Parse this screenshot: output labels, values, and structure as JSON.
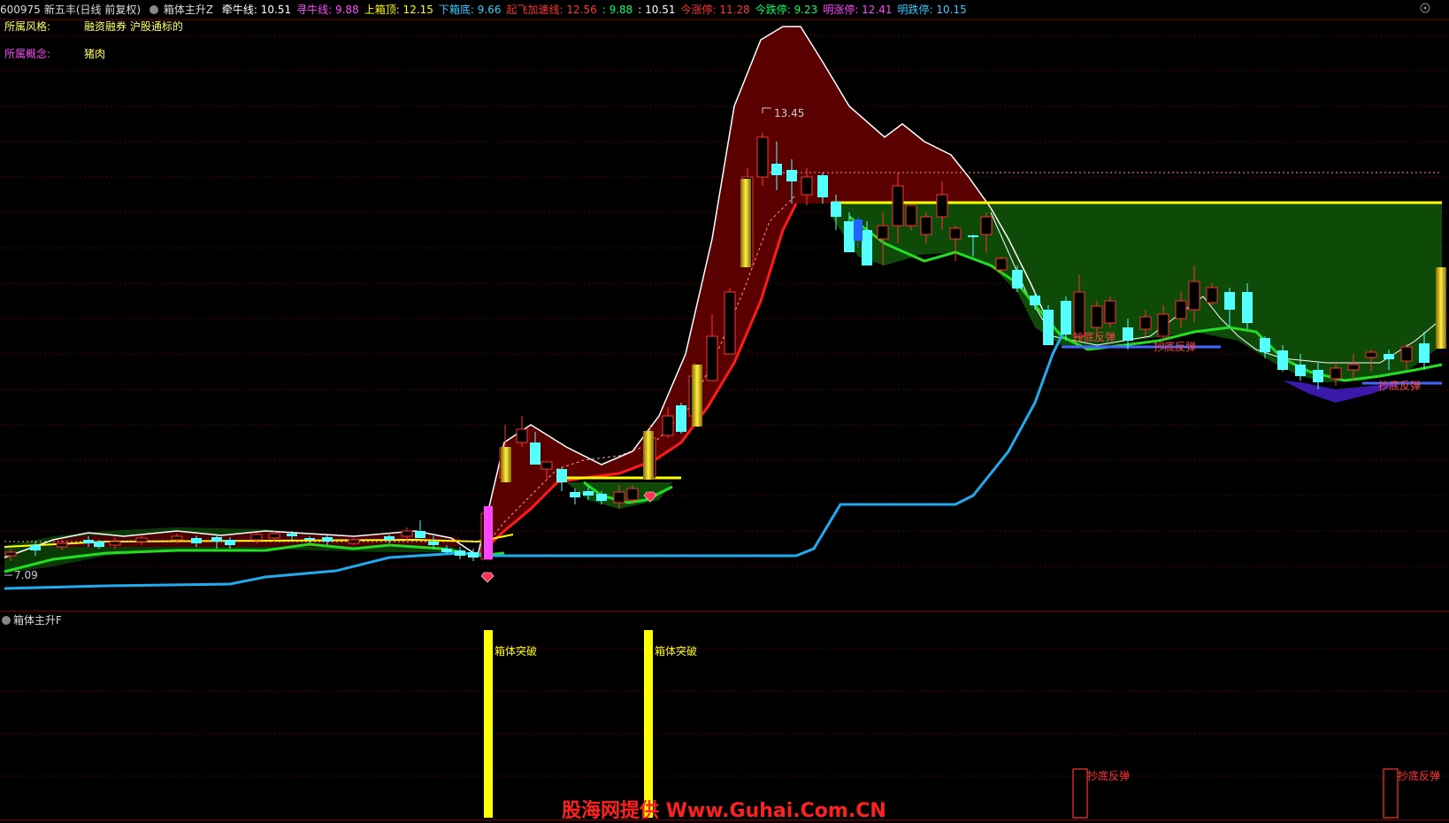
{
  "header": {
    "code": "600975",
    "name": "新五丰",
    "period": "(日线 前复权)",
    "indicator": "箱体主升Z",
    "items": [
      {
        "label": "牵牛线:",
        "value": "10.51",
        "color": "#ffffff"
      },
      {
        "label": "寻牛线:",
        "value": "9.88",
        "color": "#ff44ff"
      },
      {
        "label": "上箱顶:",
        "value": "12.15",
        "color": "#ffff00"
      },
      {
        "label": "下箱底:",
        "value": "9.66",
        "color": "#33ccff"
      },
      {
        "label": "起飞加速线:",
        "value": "12.56",
        "color": "#ff3333"
      },
      {
        "label": ":",
        "value": "9.88",
        "color": "#00ff66"
      },
      {
        "label": ":",
        "value": "10.51",
        "color": "#ffffff"
      },
      {
        "label": "今涨停:",
        "value": "11.28",
        "color": "#ff3333"
      },
      {
        "label": "今跌停:",
        "value": "9.23",
        "color": "#00ff66"
      },
      {
        "label": "明涨停:",
        "value": "12.41",
        "color": "#ff44ff"
      },
      {
        "label": "明跌停:",
        "value": "10.15",
        "color": "#33ccff"
      }
    ]
  },
  "info": {
    "style_label": "所属风格:",
    "style_value": "融资融券 沪股通标的",
    "concept_label": "所属概念:",
    "concept_value": "猪肉"
  },
  "chart_data": [
    {
      "type": "candlestick",
      "price_labels": {
        "high": "13.45",
        "low": "7.09"
      },
      "annotations": [
        "抄底反弹",
        "抄底反弹",
        "抄底反弹"
      ],
      "colors": {
        "up": "#ff3333",
        "down": "#55ffff",
        "ma_white": "#ffffff",
        "box_top": "#ffff00",
        "box_bottom": "#33ccff",
        "accel": "#ff2222",
        "green": "#22dd22"
      }
    },
    {
      "type": "bar",
      "title": "箱体主升F",
      "signals": [
        {
          "label": "箱体突破",
          "color": "#ffff00"
        },
        {
          "label": "箱体突破",
          "color": "#ffff00"
        },
        {
          "label": "抄底反弹",
          "color": "#ff3333"
        },
        {
          "label": "抄底反弹",
          "color": "#ff3333"
        }
      ]
    }
  ],
  "watermark": "股海网提供 Www.Guhai.Com.CN"
}
